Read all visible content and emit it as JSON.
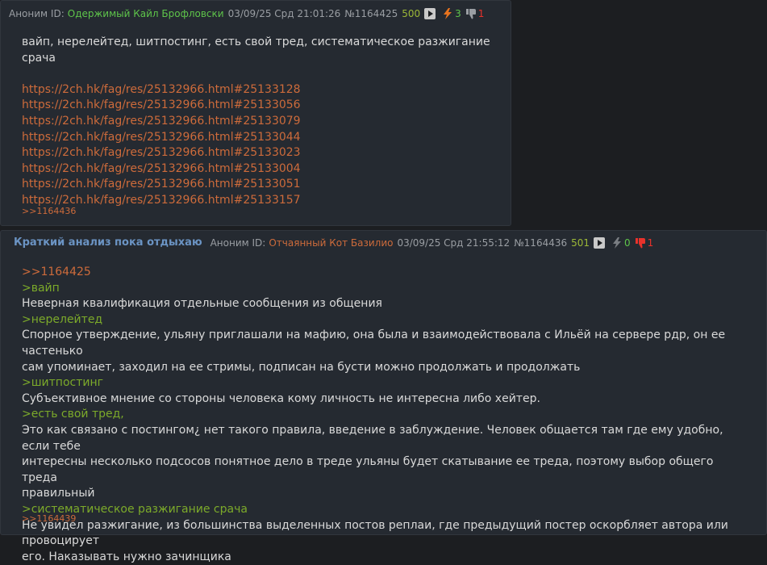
{
  "posts": [
    {
      "anon_label": "Аноним",
      "id_label": "ID:",
      "poster_name": "Одержимый Кайл Брофловски",
      "date": "03/09/25 Срд 21:01:26",
      "post_num": "№1164425",
      "count": "500",
      "likes": "3",
      "dislikes": "1",
      "like_icon_color": "#e8731e",
      "dislike_icon_color": "#9a9ea3",
      "lines": [
        "вайп, нерелейтед, шитпостинг, есть свой тред, систематическое разжигание срача"
      ],
      "links": [
        "https://2ch.hk/fag/res/25132966.html#25133128",
        "https://2ch.hk/fag/res/25132966.html#25133056",
        "https://2ch.hk/fag/res/25132966.html#25133079",
        "https://2ch.hk/fag/res/25132966.html#25133044",
        "https://2ch.hk/fag/res/25132966.html#25133023",
        "https://2ch.hk/fag/res/25132966.html#25133004",
        "https://2ch.hk/fag/res/25132966.html#25133051",
        "https://2ch.hk/fag/res/25132966.html#25133157"
      ],
      "reply": ">>1164436"
    },
    {
      "subject": "Краткий анализ пока отдыхаю",
      "anon_label": "Аноним",
      "id_label": "ID:",
      "poster_name": "Отчаянный Кот Базилио",
      "date": "03/09/25 Срд 21:55:12",
      "post_num": "№1164436",
      "count": "501",
      "likes": "0",
      "dislikes": "1",
      "like_icon_color": "#7a7e83",
      "dislike_icon_color": "#e8322b",
      "body": {
        "reply_ref": ">>1164425",
        "q1": ">вайп",
        "t1": "Неверная квалификация отдельные сообщения из общения",
        "q2": ">нерелейтед",
        "t2a": "Спорное утверждение, ульяну приглашали на мафию, она была и взаимодействовала с Ильёй на сервере рдр, он ее частенько",
        "t2b": "сам упоминает, заходил на ее стримы, подписан на бусти можно продолжать и продолжать",
        "q3": ">шитпостинг",
        "t3": "Субъективное мнение со стороны человека кому личность не интересна либо хейтер.",
        "q4": ">есть свой тред,",
        "t4a": "Это как связано с постингом¿ нет такого правила, введение в заблуждение. Человек общается там где ему удобно, если тебе",
        "t4b": "интересны несколько подсосов понятное дело в треде ульяны будет скатывание ее треда, поэтому выбор общего треда",
        "t4c": "правильный",
        "q5": ">систематическое разжигание срача",
        "t5a": "Не увидел разжигание, из большинства выделенных постов реплаи, где предыдущий постер оскорбляет автора или провоцирует",
        "t5b": "его. Наказывать нужно зачинщика"
      },
      "reply": ">>1164439"
    }
  ]
}
